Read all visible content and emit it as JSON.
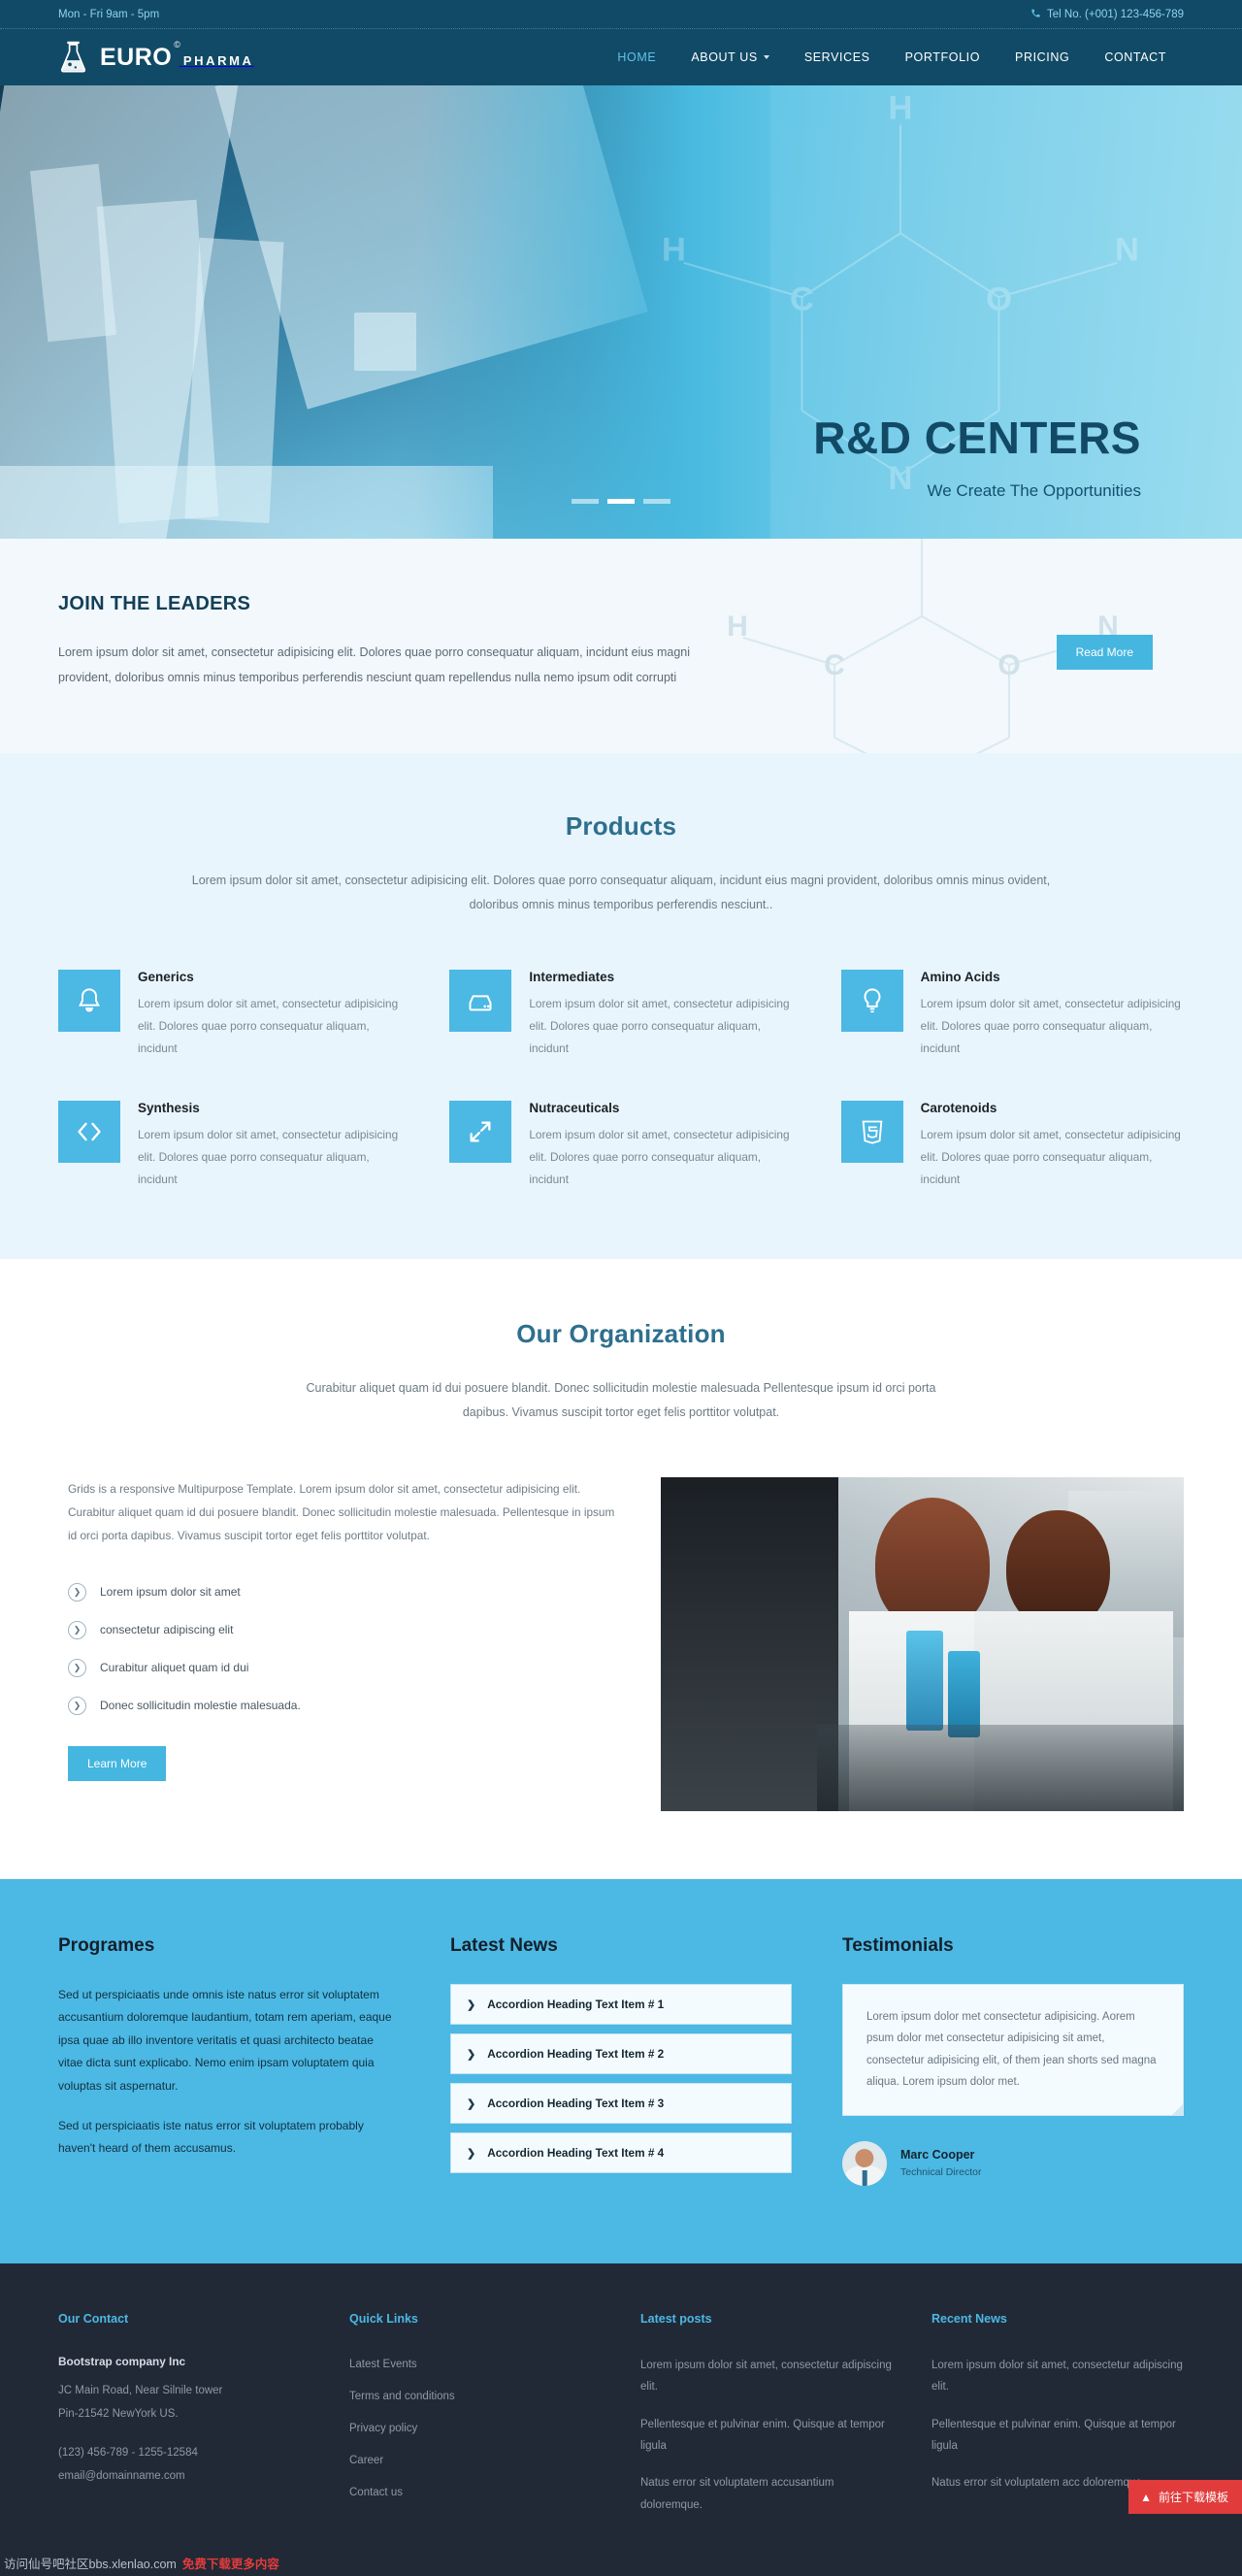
{
  "topbar": {
    "hours": "Mon - Fri 9am - 5pm",
    "tel": "Tel No. (+001) 123-456-789",
    "phone_icon": "phone-icon"
  },
  "brand": {
    "name": "EURO",
    "registered": "©",
    "tagline": "PHARMA",
    "icon": "flask-icon"
  },
  "nav": {
    "items": [
      {
        "label": "HOME",
        "active": true,
        "caret": false
      },
      {
        "label": "ABOUT US",
        "active": false,
        "caret": true
      },
      {
        "label": "SERVICES",
        "active": false,
        "caret": false
      },
      {
        "label": "PORTFOLIO",
        "active": false,
        "caret": false
      },
      {
        "label": "PRICING",
        "active": false,
        "caret": false
      },
      {
        "label": "CONTACT",
        "active": false,
        "caret": false
      }
    ]
  },
  "hero": {
    "title": "R&D CENTERS",
    "subtitle": "We Create The Opportunities",
    "slides": 3,
    "active_slide": 2
  },
  "join": {
    "title": "JOIN THE LEADERS",
    "body": "Lorem ipsum dolor sit amet, consectetur adipisicing elit. Dolores quae porro consequatur aliquam, incidunt eius magni provident, doloribus omnis minus temporibus perferendis nesciunt quam repellendus nulla nemo ipsum odit corrupti",
    "cta": "Read More"
  },
  "products": {
    "title": "Products",
    "lead": "Lorem ipsum dolor sit amet, consectetur adipisicing elit. Dolores quae porro consequatur aliquam, incidunt eius magni provident, doloribus omnis minus ovident, doloribus omnis minus temporibus perferendis nesciunt..",
    "body": "Lorem ipsum dolor sit amet, consectetur adipisicing elit. Dolores quae porro consequatur aliquam, incidunt",
    "items": [
      {
        "title": "Generics",
        "icon": "bell-icon"
      },
      {
        "title": "Intermediates",
        "icon": "hdd-icon"
      },
      {
        "title": "Amino Acids",
        "icon": "lightbulb-icon"
      },
      {
        "title": "Synthesis",
        "icon": "code-icon"
      },
      {
        "title": "Nutraceuticals",
        "icon": "expand-arrows-icon"
      },
      {
        "title": "Carotenoids",
        "icon": "html5-icon"
      }
    ]
  },
  "organization": {
    "title": "Our Organization",
    "lead": "Curabitur aliquet quam id dui posuere blandit. Donec sollicitudin molestie malesuada Pellentesque ipsum id orci porta dapibus. Vivamus suscipit tortor eget felis porttitor volutpat.",
    "paragraph": "Grids is a responsive Multipurpose Template. Lorem ipsum dolor sit amet, consectetur adipisicing elit. Curabitur aliquet quam id dui posuere blandit. Donec sollicitudin molestie malesuada. Pellentesque in ipsum id orci porta dapibus. Vivamus suscipit tortor eget felis porttitor volutpat.",
    "bullets": [
      "Lorem ipsum dolor sit amet",
      "consectetur adipiscing elit",
      "Curabitur aliquet quam id dui",
      "Donec sollicitudin molestie malesuada."
    ],
    "cta": "Learn More",
    "image_alt": "scientist-in-laboratory-photo"
  },
  "programes": {
    "title": "Programes",
    "paragraphs": [
      "Sed ut perspiciaatis unde omnis iste natus error sit voluptatem accusantium doloremque laudantium, totam rem aperiam, eaque ipsa quae ab illo inventore veritatis et quasi architecto beatae vitae dicta sunt explicabo. Nemo enim ipsam voluptatem quia voluptas sit aspernatur.",
      "Sed ut perspiciaatis iste natus error sit voluptatem probably haven't heard of them accusamus."
    ]
  },
  "latest_news": {
    "title": "Latest News",
    "items": [
      "Accordion Heading Text Item # 1",
      "Accordion Heading Text Item # 2",
      "Accordion Heading Text Item # 3",
      "Accordion Heading Text Item # 4"
    ]
  },
  "testimonials": {
    "title": "Testimonials",
    "quote": "Lorem ipsum dolor met consectetur adipisicing. Aorem psum dolor met consectetur adipisicing sit amet, consectetur adipisicing elit, of them jean shorts sed magna aliqua. Lorem ipsum dolor met.",
    "author_name": "Marc Cooper",
    "author_role": "Technical Director"
  },
  "footer": {
    "contact": {
      "title": "Our Contact",
      "company": "Bootstrap company Inc",
      "address1": "JC Main Road, Near Silnile tower",
      "address2": "Pin-21542 NewYork US.",
      "phone": "(123) 456-789 - 1255-12584",
      "email": "email@domainname.com"
    },
    "quick_links": {
      "title": "Quick Links",
      "items": [
        "Latest Events",
        "Terms and conditions",
        "Privacy policy",
        "Career",
        "Contact us"
      ]
    },
    "latest_posts": {
      "title": "Latest posts",
      "items": [
        "Lorem ipsum dolor sit amet, consectetur adipiscing elit.",
        "Pellentesque et pulvinar enim. Quisque at tempor ligula",
        "Natus error sit voluptatem accusantium doloremque."
      ]
    },
    "recent_news": {
      "title": "Recent News",
      "items": [
        "Lorem ipsum dolor sit amet, consectetur adipiscing elit.",
        "Pellentesque et pulvinar enim. Quisque at tempor ligula",
        "Natus error sit voluptatem acc doloremque."
      ]
    }
  },
  "overlay": {
    "badge": "前往下载模板",
    "badge_icon": "up-arrow-icon",
    "watermark_left": "访问仙号吧社区bbs.xlenlao.com",
    "watermark_red": "免费下载更多内容"
  },
  "colors": {
    "dark_blue": "#114a66",
    "accent_blue": "#4cb8e4",
    "hero_blue": "#49bae0",
    "section_tint": "#e8f5fc",
    "footer_dark": "#212936",
    "badge_red": "#e23b3b"
  }
}
